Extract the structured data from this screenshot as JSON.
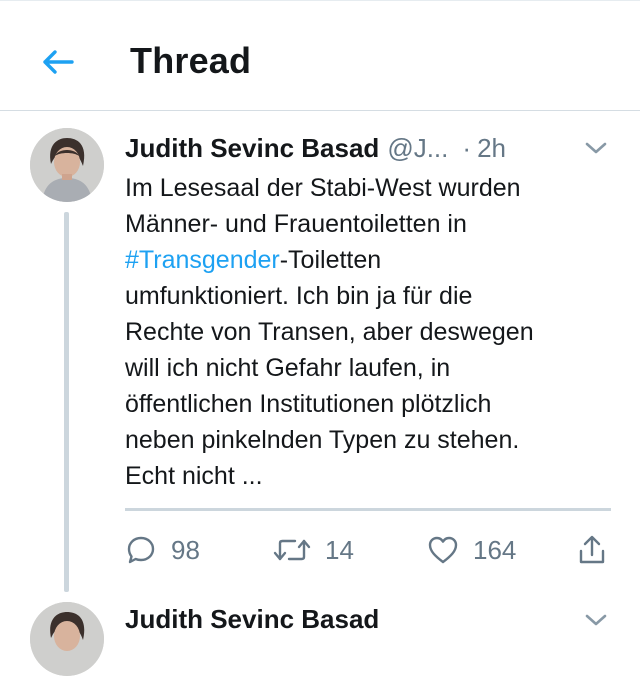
{
  "header": {
    "title": "Thread",
    "back_icon": "arrow-left-icon",
    "accent_color": "#1da1f2"
  },
  "tweets": [
    {
      "name": "Judith Sevinc Basad",
      "handle": "@J...",
      "dot": "·",
      "time": "2h",
      "text_lines": [
        {
          "plain": "Im Lesesaal der Stabi-West wurden"
        },
        {
          "plain": "Männer- und Frauentoiletten in"
        },
        {
          "hashtag": "#Transgender",
          "plain": "-Toiletten"
        },
        {
          "plain": "umfunktioniert. Ich bin ja für die"
        },
        {
          "plain": "Rechte von Transen, aber deswegen"
        },
        {
          "plain": "will ich nicht Gefahr laufen, in"
        },
        {
          "plain": "öffentlichen Institutionen plötzlich"
        },
        {
          "plain": "neben pinkelnden Typen zu stehen."
        },
        {
          "plain": "Echt nicht ..."
        }
      ],
      "actions": {
        "replies": "98",
        "retweets": "14",
        "likes": "164"
      }
    },
    {
      "name": "Judith Sevinc Basad"
    }
  ]
}
